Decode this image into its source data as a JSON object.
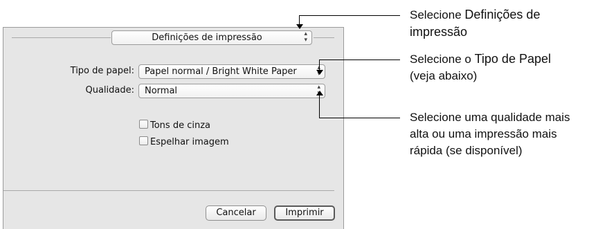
{
  "dialog": {
    "section_popup": "Definições de impressão",
    "paper_type_label": "Tipo de papel:",
    "paper_type_value": "Papel normal / Bright White Paper",
    "quality_label": "Qualidade:",
    "quality_value": "Normal",
    "grayscale_label": "Tons de cinza",
    "mirror_label": "Espelhar imagem",
    "cancel_label": "Cancelar",
    "print_label": "Imprimir"
  },
  "callouts": {
    "c1_prefix": "Selecione ",
    "c1_bold": "Definições de",
    "c1_line2": "impressão",
    "c2_prefix": "Selecione o ",
    "c2_bold": "Tipo de Papel",
    "c2_line2": "(veja abaixo)",
    "c3_line1": "Selecione uma qualidade mais",
    "c3_line2": "alta ou uma impressão mais",
    "c3_line3": "rápida (se disponível)"
  },
  "checkboxes": {
    "grayscale_checked": false,
    "mirror_checked": false
  }
}
